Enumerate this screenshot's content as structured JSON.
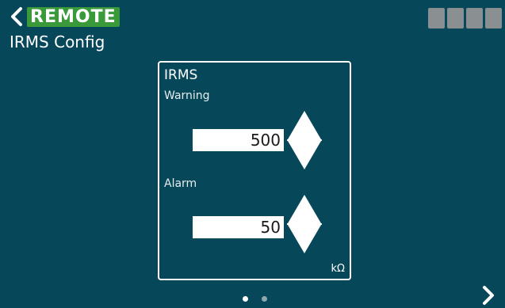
{
  "header": {
    "back_icon": "chevron-left-icon",
    "remote_badge": "REMOTE",
    "remote_badge_color": "#3a9a3a",
    "title": "IRMS Config",
    "status_indicator_count": 4
  },
  "panel": {
    "title": "IRMS",
    "warning": {
      "label": "Warning",
      "value": "500",
      "up_icon": "triangle-up-icon",
      "down_icon": "triangle-down-icon"
    },
    "alarm": {
      "label": "Alarm",
      "value": "50",
      "up_icon": "triangle-up-icon",
      "down_icon": "triangle-down-icon"
    },
    "unit": "kΩ"
  },
  "pagination": {
    "current_page": 1,
    "total_pages": 2
  },
  "footer": {
    "next_icon": "chevron-right-icon"
  },
  "colors": {
    "background": "#06475a",
    "accent": "#3a9a3a",
    "status_box": "#8a8f92"
  }
}
